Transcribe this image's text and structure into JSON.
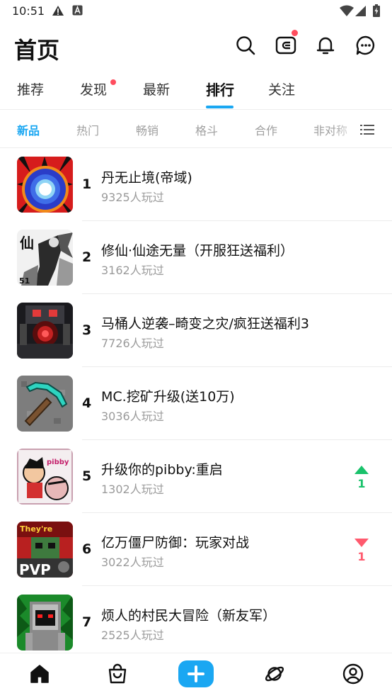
{
  "status_bar": {
    "time": "10:51",
    "icons": [
      "alert-icon",
      "a-box-icon",
      "wifi-icon",
      "signal-icon",
      "battery-icon"
    ]
  },
  "header": {
    "title": "首页",
    "actions": [
      "search-icon",
      "wallet-icon",
      "bell-icon",
      "chat-icon"
    ],
    "wallet_has_dot": true
  },
  "main_tabs": {
    "items": [
      {
        "label": "推荐",
        "active": false,
        "dot": false
      },
      {
        "label": "发现",
        "active": false,
        "dot": true
      },
      {
        "label": "最新",
        "active": false,
        "dot": false
      },
      {
        "label": "排行",
        "active": true,
        "dot": false
      },
      {
        "label": "关注",
        "active": false,
        "dot": false
      }
    ]
  },
  "sub_tabs": {
    "items": [
      {
        "label": "新品",
        "active": true
      },
      {
        "label": "热门",
        "active": false
      },
      {
        "label": "畅销",
        "active": false
      },
      {
        "label": "格斗",
        "active": false
      },
      {
        "label": "合作",
        "active": false
      },
      {
        "label": "非对称",
        "active": false
      }
    ],
    "menu_icon": "list-menu-icon"
  },
  "ranking": {
    "items": [
      {
        "rank": "1",
        "name": "丹无止境(帝域)",
        "plays": "9325人玩过",
        "trend": null,
        "trend_value": ""
      },
      {
        "rank": "2",
        "name": "修仙·仙途无量（开服狂送福利）",
        "plays": "3162人玩过",
        "trend": null,
        "trend_value": ""
      },
      {
        "rank": "3",
        "name": "马桶人逆袭–畸变之灾/疯狂送福利3",
        "plays": "7726人玩过",
        "trend": null,
        "trend_value": ""
      },
      {
        "rank": "4",
        "name": "MC.挖矿升级(送10万)",
        "plays": "3036人玩过",
        "trend": null,
        "trend_value": ""
      },
      {
        "rank": "5",
        "name": "升级你的pibby:重启",
        "plays": "1302人玩过",
        "trend": "up",
        "trend_value": "1"
      },
      {
        "rank": "6",
        "name": "亿万僵尸防御：玩家对战",
        "plays": "3022人玩过",
        "trend": "down",
        "trend_value": "1"
      },
      {
        "rank": "7",
        "name": "烦人的村民大冒险（新友军）",
        "plays": "2525人玩过",
        "trend": null,
        "trend_value": ""
      }
    ],
    "thumb_texts": {
      "2": "仙",
      "5": "pibby",
      "6a": "They're",
      "6b": "PVP"
    }
  },
  "colors": {
    "accent": "#1aa7f2",
    "dot": "#ff4d5e",
    "trend_up": "#19c26b",
    "trend_down": "#ff5a6e",
    "muted": "#9a9a9a"
  },
  "bottom_nav": {
    "items": [
      "home-icon",
      "shop-bag-icon",
      "add-icon",
      "planet-icon",
      "profile-icon"
    ],
    "active": "home-icon"
  }
}
